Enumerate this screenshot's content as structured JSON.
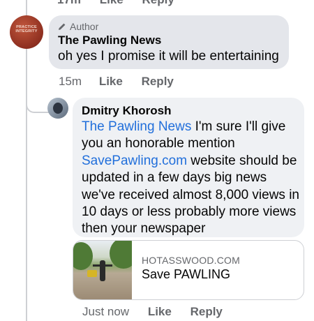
{
  "top": {
    "partial_actions": [
      "17m",
      "Like",
      "Reply"
    ]
  },
  "comment1": {
    "avatar_text": "PRACTICE INTEGRITY",
    "badge_icon": "pencil-icon",
    "badge": "Author",
    "name": "The Pawling News",
    "text": "oh yes I promise it will be entertaining",
    "time": "15m",
    "like": "Like",
    "reply": "Reply"
  },
  "comment2": {
    "name": "Dmitry Khorosh",
    "mention": "The Pawling News",
    "text_a": " I'm sure I'll give you an honorable mention ",
    "link": "SavePawling.com",
    "text_b": " website should be updated in a few days big news we've received almost 8,000 views in 10 days or less probably more views then your newspaper",
    "link_preview": {
      "domain": "HOTASSWOOD.COM",
      "title": "Save PAWLING"
    },
    "time": "Just now",
    "like": "Like",
    "reply": "Reply"
  },
  "colors": {
    "link": "#216fdb",
    "bubble": "#e4e6eb",
    "meta": "#65676b"
  }
}
